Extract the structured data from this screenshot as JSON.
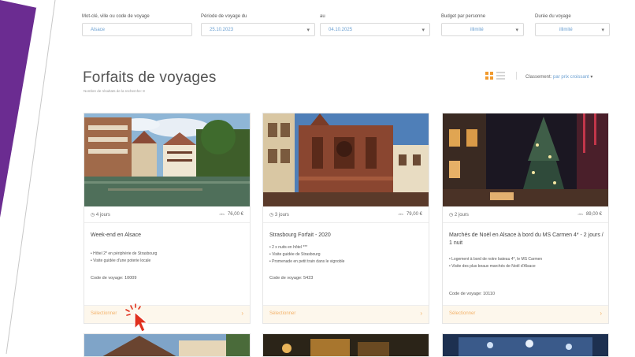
{
  "filters": [
    {
      "label": "Mot-clé, ville ou code de voyage",
      "value": "Alsace"
    },
    {
      "label": "Période de voyage du",
      "value": "25.10.2023"
    },
    {
      "label": "au",
      "value": "04.10.2025"
    },
    {
      "label": "Budget par personne",
      "value": "illimité"
    },
    {
      "label": "Durée du voyage",
      "value": "illimité"
    }
  ],
  "page": {
    "title": "Forfaits de voyages",
    "subtitle": "Nombre de résultats de la recherche: 8"
  },
  "sort": {
    "label": "Classement:",
    "value": "par prix croissant"
  },
  "cards": [
    {
      "duration": "4 jours",
      "price_prefix": "dès",
      "price": "76,00 €",
      "title": "Week-end en Alsace",
      "features": [
        "Hôtel 2* en périphérie de Strasbourg",
        "Visite guidée d'une poterie locale"
      ],
      "code": "Code de voyage: 10009",
      "select": "Sélectionner",
      "arrow": "›"
    },
    {
      "duration": "3 jours",
      "price_prefix": "dès",
      "price": "79,00 €",
      "title": "Strasbourg Forfait - 2020",
      "features": [
        "2 x nuits en hôtel ***",
        "Visite guidée de Strasbourg",
        "Promenade en petit train dans le vignoble"
      ],
      "code": "Code de voyage: 5423",
      "select": "Sélectionner",
      "arrow": "›"
    },
    {
      "duration": "2 jours",
      "price_prefix": "dès",
      "price": "89,00 €",
      "title": "Marchés de Noël en Alsace à bord du MS Carmen 4* - 2 jours / 1 nuit",
      "features": [
        "Logement à bord de notre bateau 4*, le MS Carmen",
        "Visite des plus beaux marchés de Noël d'Alsace"
      ],
      "code": "Code de voyage: 10110",
      "select": "Sélectionner",
      "arrow": "›"
    }
  ],
  "colors": {
    "accent": "#f19a2e",
    "link": "#6a9fd1",
    "brand_purple": "#6b2c91"
  }
}
